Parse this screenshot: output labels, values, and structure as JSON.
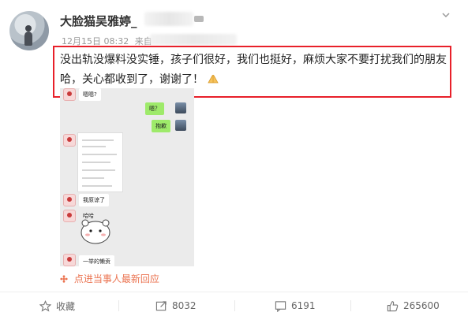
{
  "post": {
    "username": "大脸猫吴雅婷_",
    "date": "12月15日 08:32",
    "source_prefix": "来自",
    "text": "没出轨没爆料没实锤，孩子们很好，我们也挺好，麻烦大家不要打扰我们的朋友哈，关心都收到了，谢谢了！"
  },
  "screenshot": {
    "msg_top": "嗯嗯?",
    "msg_q": "嗯？",
    "msg_sorry": "抱歉",
    "msg_forgive": "我原谅了",
    "msg_haha": "哈哈",
    "msg_bottom": "一举的懒贡"
  },
  "reply_hint": "点进当事人最新回应",
  "actions": {
    "favorite": "收藏",
    "repost": "8032",
    "comment": "6191",
    "like": "265600"
  },
  "colors": {
    "highlight_border": "#e8202a",
    "reply_orange": "#eb7350"
  }
}
